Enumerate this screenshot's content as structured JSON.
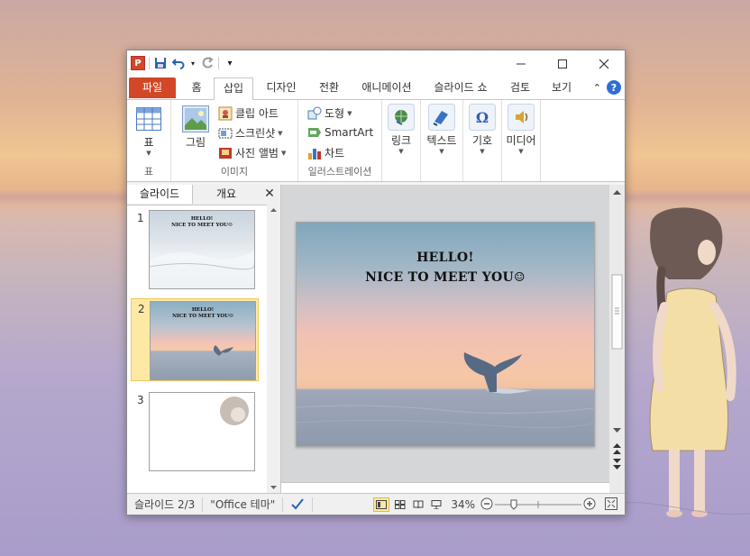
{
  "qat": {
    "app_icon_letter": "P",
    "customize_icon": "▾"
  },
  "tabs": [
    {
      "label": "파일"
    },
    {
      "label": "홈"
    },
    {
      "label": "삽입"
    },
    {
      "label": "디자인"
    },
    {
      "label": "전환"
    },
    {
      "label": "애니메이션"
    },
    {
      "label": "슬라이드 쇼"
    },
    {
      "label": "검토"
    },
    {
      "label": "보기"
    }
  ],
  "ribbon": {
    "table": {
      "button": "표",
      "group": "표"
    },
    "images": {
      "picture": "그림",
      "clipart": "클립 아트",
      "screenshot": "스크린샷",
      "album": "사진 앨범",
      "group": "이미지"
    },
    "illustrations": {
      "shapes": "도형",
      "smartart": "SmartArt",
      "chart": "차트",
      "group": "일러스트레이션"
    },
    "links": {
      "button": "링크"
    },
    "text": {
      "button": "텍스트"
    },
    "symbols": {
      "button": "기호"
    },
    "media": {
      "button": "미디어"
    }
  },
  "panel": {
    "tab_slides": "슬라이드",
    "tab_outline": "개요",
    "close": "✕"
  },
  "slides": [
    {
      "num": "1",
      "line1": "HELLO!",
      "line2": "NICE TO MEET YOU☺"
    },
    {
      "num": "2",
      "line1": "HELLO!",
      "line2": "NICE TO MEET YOU☺"
    },
    {
      "num": "3"
    }
  ],
  "main_slide": {
    "line1": "HELLO!",
    "line2": "NICE TO MEET YOU☺"
  },
  "status": {
    "slide_pos": "슬라이드 2/3",
    "theme": "\"Office 테마\"",
    "zoom": "34%"
  }
}
